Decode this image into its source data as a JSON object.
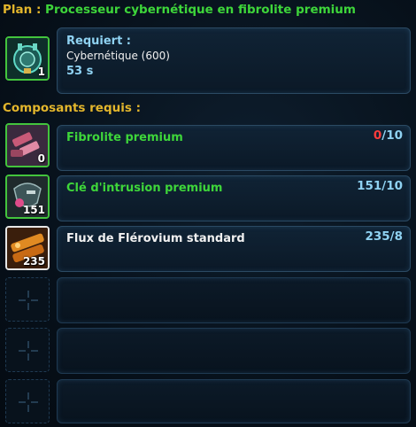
{
  "plan": {
    "prefix": "Plan : ",
    "name": "Processeur cybernétique en fibrolite premium"
  },
  "requirement": {
    "label": "Requiert :",
    "skill": "Cybernétique (600)",
    "time": "53 s",
    "icon_count": "1"
  },
  "section_label": "Composants requis :",
  "components": [
    {
      "name": "Fibrolite premium",
      "have": "0",
      "need": "/10",
      "icon_count": "0",
      "icon": "fibrolite-icon",
      "quality_color": "#3ed63a"
    },
    {
      "name": "Clé d'intrusion premium",
      "have": "151",
      "need": "/10",
      "icon_count": "151",
      "icon": "intrusion-key-icon",
      "quality_color": "#3ed63a"
    },
    {
      "name": "Flux de Flérovium standard",
      "have": "235",
      "need": "/8",
      "icon_count": "235",
      "icon": "flerovium-flux-icon",
      "quality_color": "#f0f0f0"
    }
  ],
  "colors": {
    "premium_green": "#3ed63a",
    "header_gold": "#e3b62c",
    "accent_blue": "#8fd2f2",
    "missing_red": "#ff3b3b"
  }
}
